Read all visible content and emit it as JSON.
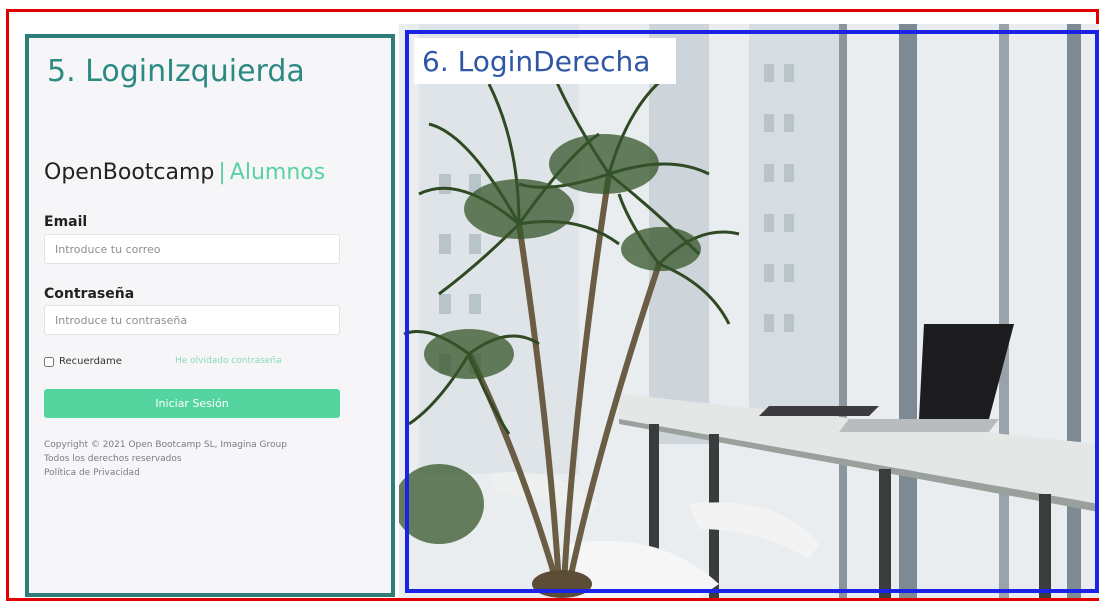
{
  "labels": {
    "left_panel_tag": "5. LoginIzquierda",
    "right_panel_tag": "6. LoginDerecha"
  },
  "brand": {
    "name": "OpenBootcamp",
    "separator": "|",
    "accent": "Alumnos"
  },
  "form": {
    "email_label": "Email",
    "email_placeholder": "Introduce tu correo",
    "password_label": "Contraseña",
    "password_placeholder": "Introduce tu contraseña",
    "remember_label": "Recuerdame",
    "forgot_link": "He olvidado contraseña",
    "submit_label": "Iniciar Sesión"
  },
  "footer": {
    "copyright": "Copyright © 2021 Open Bootcamp SL, Imagina Group",
    "rights": "Todos los derechos reservados",
    "privacy": "Política de Privacidad"
  },
  "colors": {
    "outer_frame": "#e10000",
    "left_frame": "#2f7d79",
    "right_frame": "#1a23e6",
    "accent": "#54d49e"
  },
  "image": {
    "description_icon": "office-photo"
  }
}
